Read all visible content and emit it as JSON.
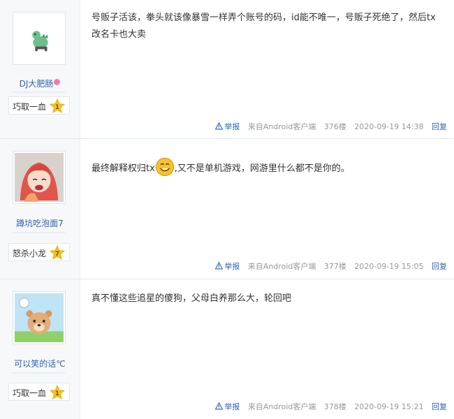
{
  "posts": [
    {
      "username": "DJ大肥肠",
      "badge": "巧取一血",
      "level": "1",
      "content": "号贩子活该，拳头就该像暴雪一样弄个账号的码，id能不唯一，号贩子死绝了，然后tx改名卡也大卖",
      "report": "举报",
      "source": "来自Android客户端",
      "floor": "376楼",
      "time": "2020-09-19 14:38",
      "reply": "回复"
    },
    {
      "username": "蹲坑吃泡面7",
      "badge": "怒杀小龙",
      "level": "7",
      "content_a": "最终解释权归tx",
      "content_b": ",又不是单机游戏，网游里什么都不是你的。",
      "report": "举报",
      "source": "来自Android客户端",
      "floor": "377楼",
      "time": "2020-09-19 15:05",
      "reply": "回复"
    },
    {
      "username": "可以笑的话℃",
      "badge": "巧取一血",
      "level": "1",
      "content": "真不懂这些追星的傻狗，父母白养那么大，轮回吧",
      "report": "举报",
      "source": "来自Android客户端",
      "floor": "378楼",
      "time": "2020-09-19 15:21",
      "reply": "回复"
    }
  ],
  "colors": {
    "link": "#2d64b3",
    "meta": "#999999",
    "sidebar": "#f7f8fa",
    "level_star": "#f5c518"
  }
}
